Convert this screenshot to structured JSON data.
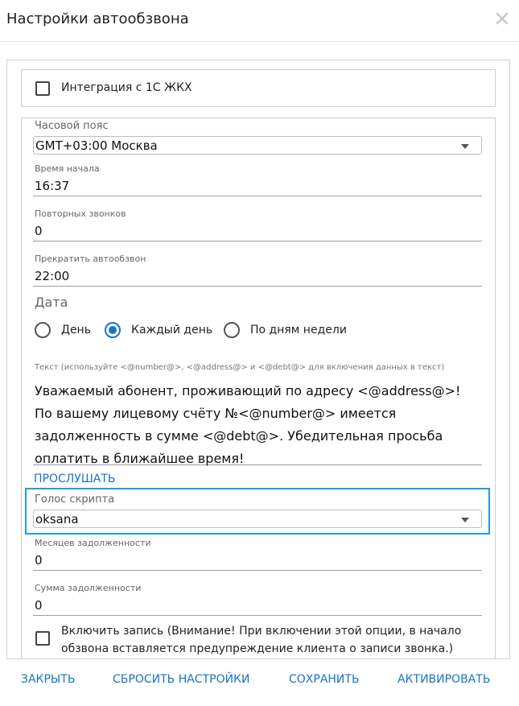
{
  "dialog": {
    "title": "Настройки автообзвона",
    "close_icon": "close-icon"
  },
  "integration": {
    "label": "Интеграция с 1С ЖКХ",
    "checked": false
  },
  "timezone": {
    "label": "Часовой пояс",
    "value": "GMT+03:00 Москва"
  },
  "start_time": {
    "label": "Время начала",
    "value": "16:37"
  },
  "repeat_calls": {
    "label": "Повторных звонков",
    "value": "0"
  },
  "stop_time": {
    "label": "Прекратить автообзвон",
    "value": "22:00"
  },
  "date": {
    "label": "Дата",
    "options": [
      {
        "label": "День",
        "selected": false
      },
      {
        "label": "Каждый день",
        "selected": true
      },
      {
        "label": "По дням недели",
        "selected": false
      }
    ]
  },
  "text": {
    "hint": "Текст (используйте <@number@>, <@address@> и <@debt@> для включения данных в текст)",
    "value": "Уважаемый абонент, проживающий по адресу <@address@>!  По вашему лицевому счёту №<@number@> имеется задолженность в сумме <@debt@>. Убедительная просьба оплатить в ближайшее время!"
  },
  "listen_label": "ПРОСЛУШАТЬ",
  "voice": {
    "label": "Голос скрипта",
    "value": "oksana"
  },
  "debt_months": {
    "label": "Месяцев задолженности",
    "value": "0"
  },
  "debt_sum": {
    "label": "Сумма задолженности",
    "value": "0"
  },
  "recording": {
    "label": "Включить запись (Внимание! При включении этой опции, в начало обзвона вставляется предупреждение клиента о записи звонка.)",
    "checked": false
  },
  "footer": {
    "close": "ЗАКРЫТЬ",
    "reset": "СБРОСИТЬ НАСТРОЙКИ",
    "save": "СОХРАНИТЬ",
    "activate": "АКТИВИРОВАТЬ"
  },
  "colors": {
    "accent": "#1a73c9",
    "highlight": "#1ea0dc"
  }
}
